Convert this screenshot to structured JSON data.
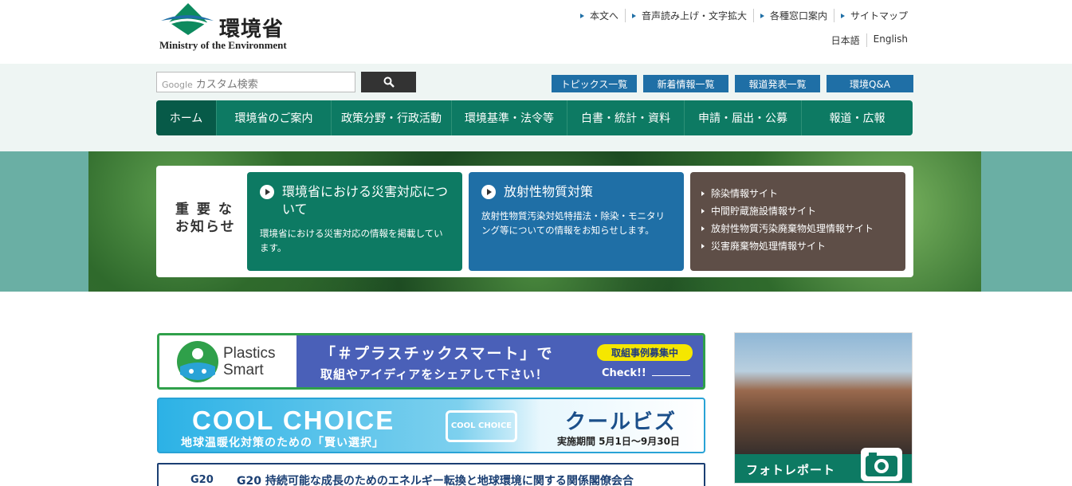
{
  "header": {
    "logo_jp": "環境省",
    "logo_en": "Ministry of the Environment",
    "utility": [
      "本文へ",
      "音声読み上げ・文字拡大",
      "各種窓口案内",
      "サイトマップ"
    ],
    "languages": [
      "日本語",
      "English"
    ]
  },
  "search": {
    "google_label": "Google",
    "placeholder": "カスタム検索"
  },
  "quick_links": [
    "トピックス一覧",
    "新着情報一覧",
    "報道発表一覧",
    "環境Q&A"
  ],
  "nav": [
    "ホーム",
    "環境省のご案内",
    "政策分野・行政活動",
    "環境基準・法令等",
    "白書・統計・資料",
    "申請・届出・公募",
    "報道・広報"
  ],
  "notice": {
    "title": "重 要 な\nお知らせ",
    "card1": {
      "heading": "環境省における災害対応について",
      "text": "環境省における災害対応の情報を掲載しています。"
    },
    "card2": {
      "heading": "放射性物質対策",
      "text": "放射性物質汚染対処特措法・除染・モニタリング等についての情報をお知らせします。"
    },
    "card3_links": [
      "除染情報サイト",
      "中間貯蔵施設情報サイト",
      "放射性物質汚染廃棄物処理情報サイト",
      "災害廃棄物処理情報サイト"
    ]
  },
  "banners": {
    "plastics": {
      "logo_text_1": "Plastics",
      "logo_text_2": "Smart",
      "line1": "「＃プラスチックスマート」で",
      "line2": "取組やアイディアをシェアして下さい！",
      "badge": "取組事例募集中",
      "check": "Check!!"
    },
    "coolchoice": {
      "title": "COOL CHOICE",
      "subtitle": "地球温暖化対策のための「賢い選択」",
      "logo": "COOL CHOICE",
      "coolbiz": "クールビズ",
      "period": "実施期間 5月1日〜9月30日"
    },
    "g20": {
      "mark": "G20",
      "title": "G20 持続可能な成長のためのエネルギー転換と地球環境に関する関係閣僚会合"
    }
  },
  "photo_report": {
    "label": "フォトレポート"
  },
  "colors": {
    "green": "#0d7a63",
    "blue": "#1f6fa6",
    "brown": "#5e4e47"
  }
}
